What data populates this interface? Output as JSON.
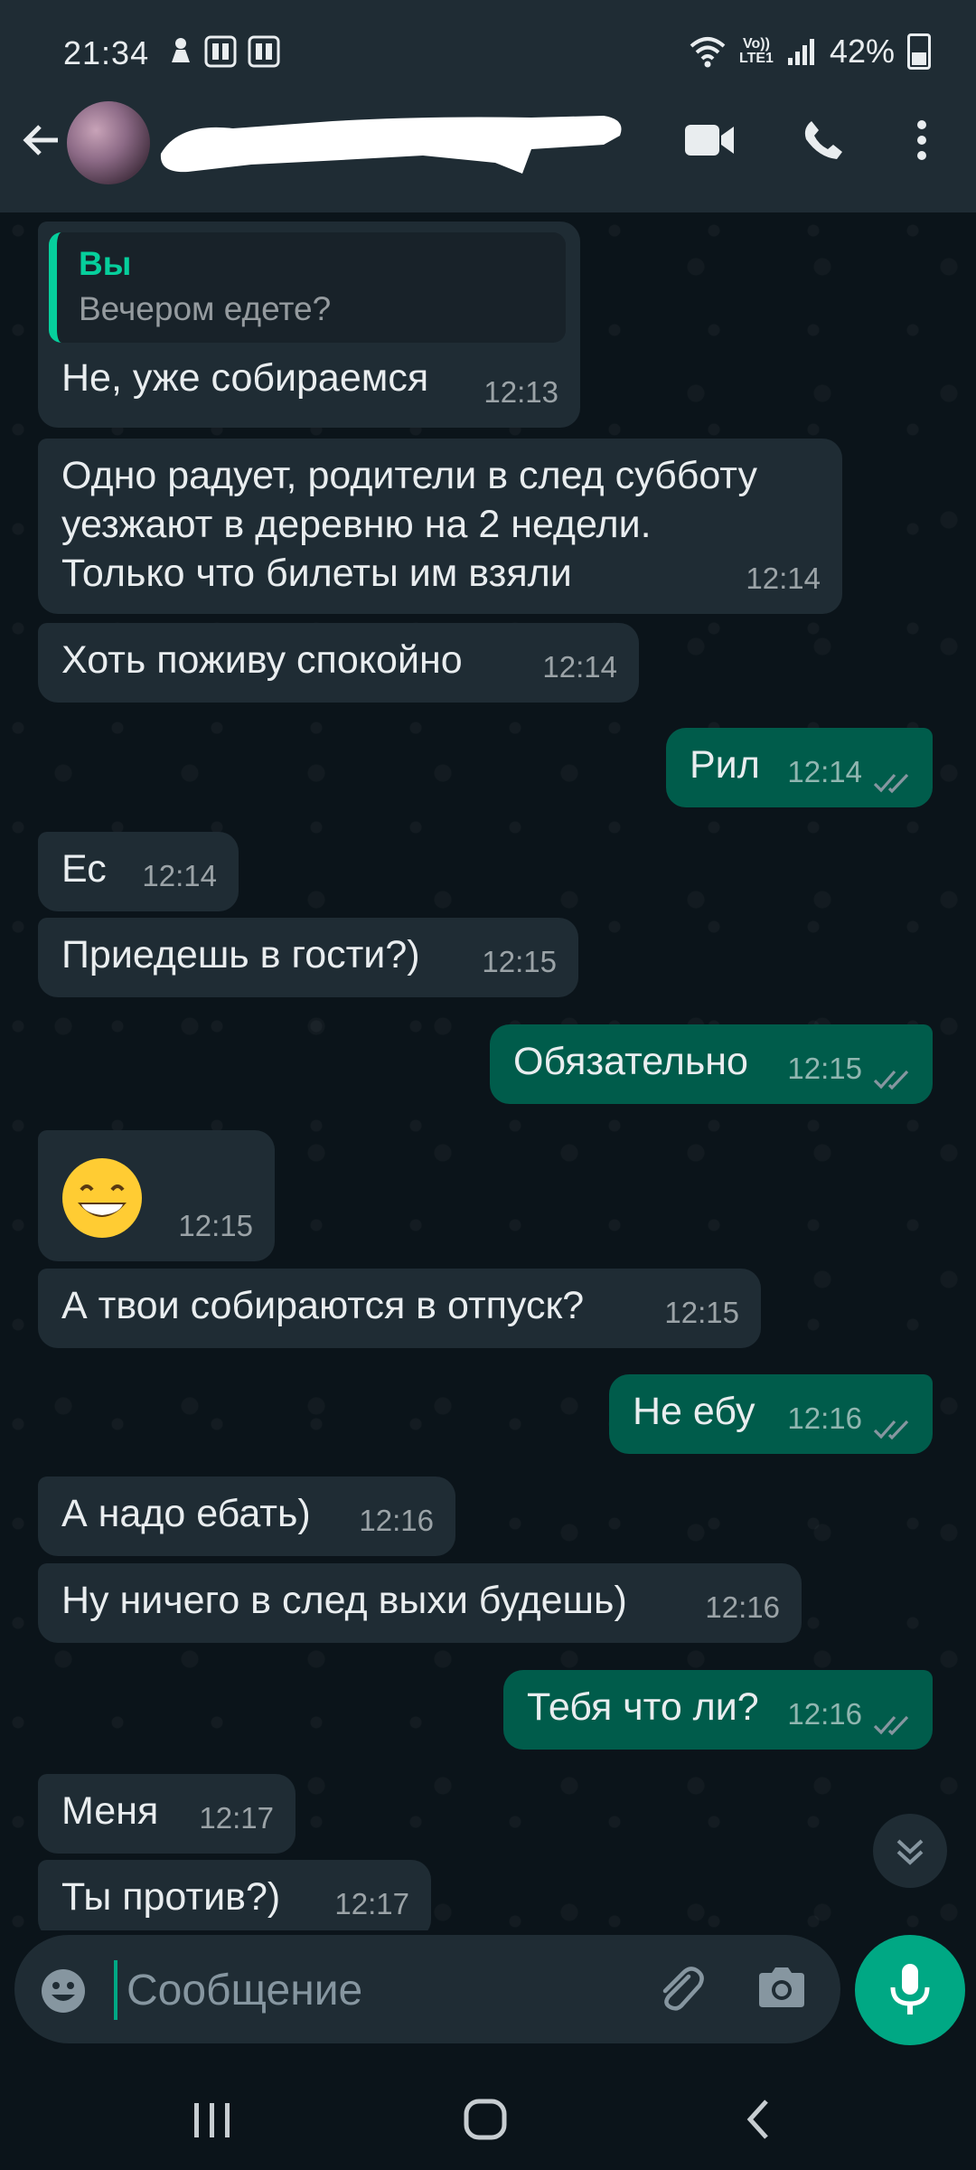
{
  "status_bar": {
    "time": "21:34",
    "battery": "42%",
    "network_label": "LTE1",
    "icons": [
      "notification-person-icon",
      "app-notification-icon",
      "app-notification-icon",
      "wifi-icon",
      "volte-icon",
      "signal-icon",
      "battery-icon"
    ],
    "battery_level": 0.42
  },
  "header": {
    "contact_name": "",
    "icons": [
      "back-arrow-icon",
      "avatar",
      "video-call-icon",
      "voice-call-icon",
      "more-icon"
    ]
  },
  "messages": [
    {
      "dir": "in",
      "quote": {
        "author": "Вы",
        "text": "Вечером едете?"
      },
      "text": "Не, уже собираемся",
      "time": "12:13"
    },
    {
      "dir": "in",
      "lines": [
        "Одно радует, родители в след субботу",
        "уезжают в деревню на 2 недели.",
        "Только что билеты им взяли"
      ],
      "time": "12:14"
    },
    {
      "dir": "in",
      "text": "Хоть поживу спокойно",
      "time": "12:14"
    },
    {
      "dir": "out",
      "text": "Рил",
      "time": "12:14",
      "read": true
    },
    {
      "dir": "in",
      "text": "Ес",
      "time": "12:14"
    },
    {
      "dir": "in",
      "text": "Приедешь в гости?)",
      "time": "12:15"
    },
    {
      "dir": "out",
      "text": "Обязательно",
      "time": "12:15",
      "read": true
    },
    {
      "dir": "in",
      "text": "😁",
      "time": "12:15",
      "emoji_only": true
    },
    {
      "dir": "in",
      "text": "А твои собираются в отпуск?",
      "time": "12:15"
    },
    {
      "dir": "out",
      "text": "Не ебу",
      "time": "12:16",
      "read": true
    },
    {
      "dir": "in",
      "text": "А надо ебать)",
      "time": "12:16"
    },
    {
      "dir": "in",
      "text": "Ну ничего в след выхи будешь)",
      "time": "12:16"
    },
    {
      "dir": "out",
      "text": "Тебя что ли?",
      "time": "12:16",
      "read": true
    },
    {
      "dir": "in",
      "text": "Меня",
      "time": "12:17"
    },
    {
      "dir": "in",
      "text": "Ты против?)",
      "time": "12:17"
    }
  ],
  "composer": {
    "placeholder": "Сообщение",
    "value": "",
    "icons": [
      "emoji-icon",
      "attach-icon",
      "camera-icon",
      "mic-icon"
    ]
  },
  "colors": {
    "background": "#0b141a",
    "bar": "#1f2c34",
    "incoming": "#1f2c34",
    "outgoing": "#005c4b",
    "accent": "#00a884",
    "read_ticks": "#8696a0"
  }
}
